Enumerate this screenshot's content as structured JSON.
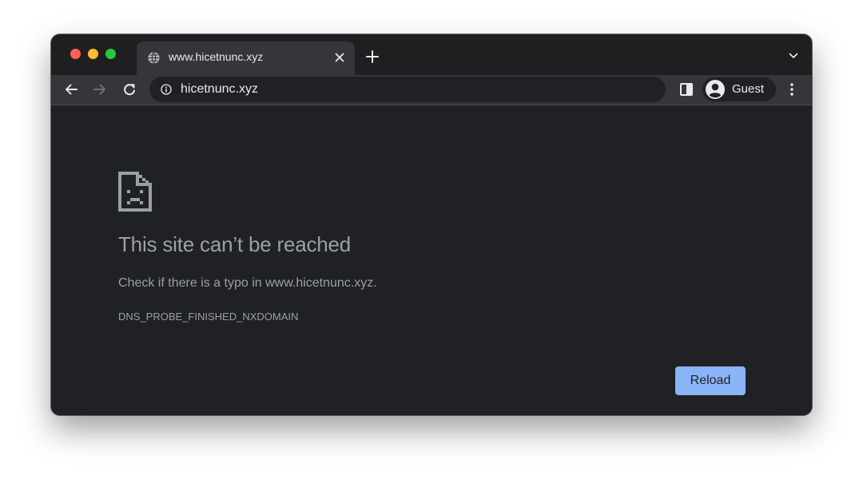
{
  "tab": {
    "title": "www.hicetnunc.xyz",
    "favicon": "globe-icon",
    "close_icon": "close-icon"
  },
  "tabstrip": {
    "new_tab_icon": "plus-icon",
    "tab_search_icon": "chevron-down-icon"
  },
  "toolbar": {
    "back_icon": "arrow-left-icon",
    "forward_icon": "arrow-right-icon",
    "reload_icon": "reload-icon",
    "site_info_icon": "info-icon",
    "url": "hicetnunc.xyz",
    "side_panel_icon": "side-panel-icon",
    "profile_icon": "avatar-icon",
    "profile_name": "Guest",
    "menu_icon": "kebab-menu-icon"
  },
  "error_page": {
    "icon": "sad-document-icon",
    "heading": "This site can’t be reached",
    "suggestion": "Check if there is a typo in www.hicetnunc.xyz.",
    "error_code": "DNS_PROBE_FINISHED_NXDOMAIN",
    "reload_label": "Reload"
  },
  "colors": {
    "window_background": "#202124",
    "toolbar_background": "#35363a",
    "tab_strip_background": "#1f1f21",
    "text_primary": "#e8eaed",
    "text_secondary": "#9aa0a6",
    "accent": "#8ab4f8",
    "traffic_red": "#fe5f57",
    "traffic_yellow": "#febc2e",
    "traffic_green": "#28c840"
  }
}
